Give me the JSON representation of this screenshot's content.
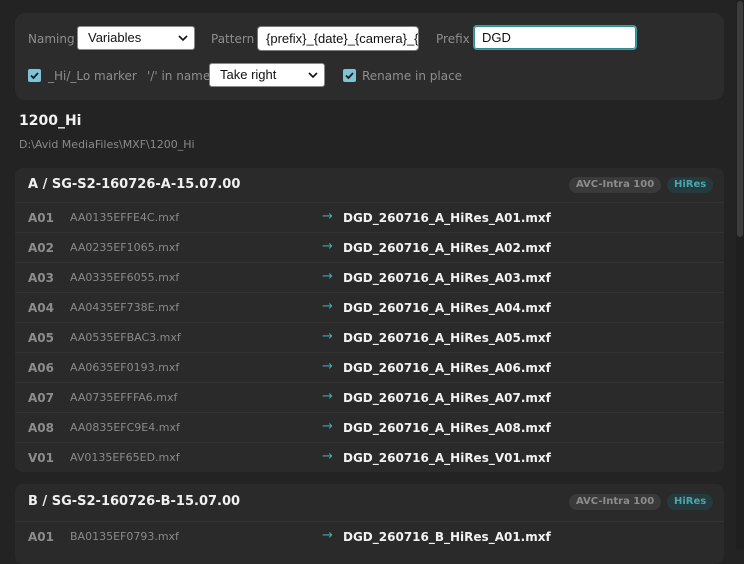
{
  "settings": {
    "naming_label": "Naming",
    "naming_value": "Variables",
    "pattern_label": "Pattern",
    "pattern_value": "{prefix}_{date}_{camera}_{r",
    "prefix_label": "Prefix",
    "prefix_value": "DGD",
    "hilo_label": "_Hi/_Lo marker",
    "hilo_checked": true,
    "slash_label": "'/' in name",
    "slash_value": "Take right",
    "rename_label": "Rename in place",
    "rename_checked": true
  },
  "folder": {
    "title": "1200_Hi",
    "path": "D:\\Avid MediaFiles\\MXF\\1200_Hi"
  },
  "groups": [
    {
      "title": "A / SG-S2-160726-A-15.07.00",
      "codec": "AVC-Intra 100",
      "res": "HiRes",
      "rows": [
        {
          "id": "A01",
          "src": "AA0135EFFE4C.mxf",
          "dst": "DGD_260716_A_HiRes_A01.mxf"
        },
        {
          "id": "A02",
          "src": "AA0235EF1065.mxf",
          "dst": "DGD_260716_A_HiRes_A02.mxf"
        },
        {
          "id": "A03",
          "src": "AA0335EF6055.mxf",
          "dst": "DGD_260716_A_HiRes_A03.mxf"
        },
        {
          "id": "A04",
          "src": "AA0435EF738E.mxf",
          "dst": "DGD_260716_A_HiRes_A04.mxf"
        },
        {
          "id": "A05",
          "src": "AA0535EFBAC3.mxf",
          "dst": "DGD_260716_A_HiRes_A05.mxf"
        },
        {
          "id": "A06",
          "src": "AA0635EF0193.mxf",
          "dst": "DGD_260716_A_HiRes_A06.mxf"
        },
        {
          "id": "A07",
          "src": "AA0735EFFFA6.mxf",
          "dst": "DGD_260716_A_HiRes_A07.mxf"
        },
        {
          "id": "A08",
          "src": "AA0835EFC9E4.mxf",
          "dst": "DGD_260716_A_HiRes_A08.mxf"
        },
        {
          "id": "V01",
          "src": "AV0135EF65ED.mxf",
          "dst": "DGD_260716_A_HiRes_V01.mxf"
        }
      ]
    },
    {
      "title": "B / SG-S2-160726-B-15.07.00",
      "codec": "AVC-Intra 100",
      "res": "HiRes",
      "rows": [
        {
          "id": "A01",
          "src": "BA0135EF0793.mxf",
          "dst": "DGD_260716_B_HiRes_A01.mxf"
        }
      ]
    }
  ],
  "arrow_glyph": "→",
  "check_glyph": "✓",
  "chevron_glyph": "⌄",
  "colors": {
    "accent": "#3fa7ae",
    "check": "#7cc4d8",
    "background": "#232323",
    "panel": "#2c2c2c"
  }
}
